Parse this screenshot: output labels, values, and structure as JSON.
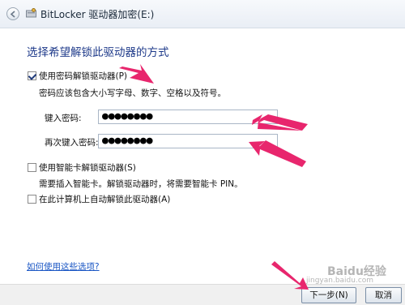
{
  "window": {
    "title": "BitLocker 驱动器加密(E:)"
  },
  "main": {
    "heading": "选择希望解锁此驱动器的方式",
    "option_password": {
      "label": "使用密码解锁驱动器(P)",
      "checked": true,
      "hint": "密码应该包含大小写字母、数字、空格以及符号。"
    },
    "password_field": {
      "label": "键入密码:",
      "value": "●●●●●●●●"
    },
    "confirm_field": {
      "label": "再次键入密码:",
      "value": "●●●●●●●●"
    },
    "option_smartcard": {
      "label": "使用智能卡解锁驱动器(S)",
      "checked": false,
      "hint": "需要插入智能卡。解锁驱动器时，将需要智能卡 PIN。"
    },
    "option_auto": {
      "label": "在此计算机上自动解锁此驱动器(A)",
      "checked": false
    },
    "help_link": "如何使用这些选项?"
  },
  "footer": {
    "next_label": "下一步(N)",
    "cancel_label": "取消"
  },
  "watermark": {
    "line1": "Baidu经验",
    "line2": "jingyan.baidu.com"
  },
  "colors": {
    "annotation_arrow": "#e8266d",
    "heading": "#1e3a8a",
    "link": "#1a56c4"
  }
}
